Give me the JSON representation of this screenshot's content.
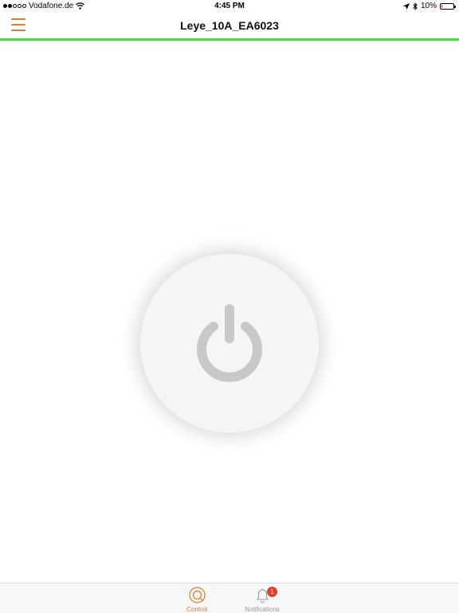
{
  "status_bar": {
    "carrier": "Vodafone.de",
    "time": "4:45 PM",
    "battery": "10%",
    "battery_level": 0.1,
    "signal_bars_filled": 2,
    "signal_bars_total": 5
  },
  "nav": {
    "title": "Leye_10A_EA6023",
    "status_color": "#44dd3a",
    "accent_color": "#e07a2e"
  },
  "power_button": {
    "icon": "power-icon"
  },
  "tabs": [
    {
      "label": "Control",
      "icon": "control-icon",
      "active": true
    },
    {
      "label": "Notifications",
      "icon": "bell-icon",
      "badge": "1",
      "active": false
    }
  ]
}
